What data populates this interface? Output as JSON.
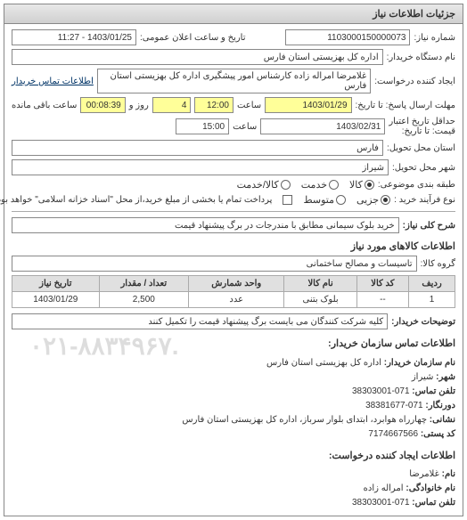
{
  "panel_title": "جزئیات اطلاعات نیاز",
  "fields": {
    "req_number_label": "شماره نیاز:",
    "req_number": "1103000150000073",
    "announce_label": "تاریخ و ساعت اعلان عمومی:",
    "announce_value": "1403/01/25 - 11:27",
    "buyer_org_label": "نام دستگاه خریدار:",
    "buyer_org": "اداره کل بهزیستی استان فارس",
    "requester_label": "ایجاد کننده درخواست:",
    "requester": "غلامرضا امراله زاده کارشناس امور پیشگیری اداره کل بهزیستی استان فارس",
    "buyer_contact_btn": "اطلاعات تماس خریدار",
    "deadline_reply_label": "مهلت ارسال پاسخ:",
    "deadline_reply_to": "تا تاریخ:",
    "deadline_reply_date": "1403/01/29",
    "deadline_reply_time_label": "ساعت",
    "deadline_reply_time": "12:00",
    "deadline_reply_days_label": "روز و",
    "deadline_reply_days": "4",
    "deadline_reply_remain_label": "ساعت باقی مانده",
    "deadline_reply_remain": "00:08:39",
    "validity_label": "حداقل تاریخ اعتبار",
    "validity_to": "قیمت: تا تاریخ:",
    "validity_date": "1403/02/31",
    "validity_time_label": "ساعت",
    "validity_time": "15:00",
    "province_label": "استان محل تحویل:",
    "province": "فارس",
    "city_label": "شهر محل تحویل:",
    "city": "شیراز",
    "category_label": "طبقه بندی موضوعی:",
    "cat_goods": "کالا",
    "cat_service": "خدمت",
    "cat_goods_service": "کالا/خدمت",
    "purchase_type_label": "نوع فرآیند خرید :",
    "pt_minor": "جزیی",
    "pt_medium": "متوسط",
    "pt_note": "پرداخت تمام یا بخشی از مبلغ خرید،از محل \"اسناد خزانه اسلامی\" خواهد بود.",
    "main_title_label": "شرح کلی نیاز:",
    "main_title": "خرید بلوک سیمانی مطابق با مندرجات در برگ پیشنهاد قیمت",
    "goods_section": "اطلاعات کالاهای مورد نیاز",
    "goods_group_label": "گروه کالا:",
    "goods_group": "تاسیسات و مصالح ساختمانی",
    "buyer_notes_label": "توضیحات خریدار:",
    "buyer_notes": "کلیه شرکت کنندگان می بایست برگ پیشنهاد قیمت را تکمیل کنند",
    "contact_section": "اطلاعات تماس سازمان خریدار:",
    "c_org_label": "نام سازمان خریدار:",
    "c_org": "اداره کل بهزیستی استان فارس",
    "c_city_label": "شهر:",
    "c_city": "شیراز",
    "c_phone_label": "تلفن تماس:",
    "c_phone": "071-38303001",
    "c_fax_label": "دورنگار:",
    "c_fax": "071-38381677",
    "c_addr_label": "نشانی:",
    "c_addr": "چهارراه هوابرد، ابتدای بلوار سرباز، اداره کل بهزیستی استان فارس",
    "c_post_label": "کد پستی:",
    "c_post": "7174667566",
    "req_creator_section": "اطلاعات ایجاد کننده درخواست:",
    "rc_name_label": "نام:",
    "rc_name": "غلامرضا",
    "rc_family_label": "نام خانوادگی:",
    "rc_family": "امراله زاده",
    "rc_phone_label": "تلفن تماس:",
    "rc_phone": "071-38303001",
    "watermark": "۰۲۱-۸۸۳۴۹۶۷."
  },
  "table": {
    "headers": [
      "ردیف",
      "کد کالا",
      "نام کالا",
      "واحد شمارش",
      "تعداد / مقدار",
      "تاریخ نیاز"
    ],
    "rows": [
      [
        "1",
        "--",
        "بلوک بتنی",
        "عدد",
        "2,500",
        "1403/01/29"
      ]
    ]
  }
}
